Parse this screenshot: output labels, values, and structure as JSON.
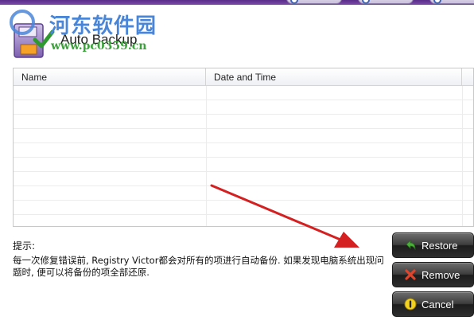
{
  "header": {
    "title": "Auto Backup",
    "watermark_title": "河东软件园",
    "watermark_url": "www.pc0359.cn"
  },
  "table": {
    "columns": [
      "Name",
      "Date and Time"
    ],
    "rows": []
  },
  "hint": {
    "label": "提示:",
    "text": "每一次修复错误前, Registry Victor都会对所有的项进行自动备份. 如果发现电脑系统出现问题时, 便可以将备份的项全部还原."
  },
  "buttons": {
    "restore": "Restore",
    "remove": "Remove",
    "cancel": "Cancel"
  },
  "colors": {
    "watermark_title": "#4a86d8",
    "watermark_url": "#3aa33a",
    "button_bg": "#2e2e2e",
    "arrow": "#d42020"
  }
}
